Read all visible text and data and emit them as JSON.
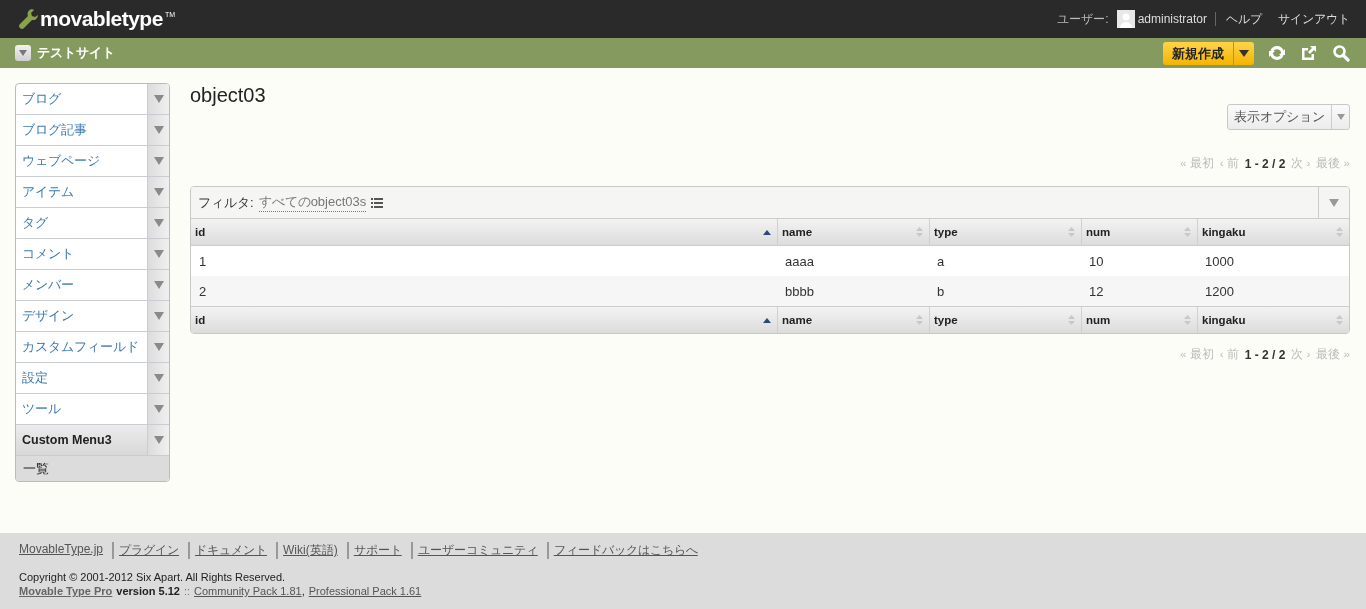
{
  "header": {
    "logo": "movabletype",
    "trademark": "TM",
    "user_label": "ユーザー:",
    "user_name": "administrator",
    "links": [
      "ヘルプ",
      "サインアウト"
    ]
  },
  "site_bar": {
    "site_name": "テストサイト",
    "create_button": "新規作成"
  },
  "sidebar": {
    "items": [
      {
        "label": "ブログ",
        "expanded": false
      },
      {
        "label": "ブログ記事",
        "expanded": false
      },
      {
        "label": "ウェブページ",
        "expanded": false
      },
      {
        "label": "アイテム",
        "expanded": false
      },
      {
        "label": "タグ",
        "expanded": false
      },
      {
        "label": "コメント",
        "expanded": false
      },
      {
        "label": "メンバー",
        "expanded": false
      },
      {
        "label": "デザイン",
        "expanded": false
      },
      {
        "label": "カスタムフィールド",
        "expanded": false
      },
      {
        "label": "設定",
        "expanded": false
      },
      {
        "label": "ツール",
        "expanded": false
      },
      {
        "label": "Custom Menu3",
        "expanded": true,
        "children": [
          {
            "label": "一覧"
          }
        ]
      }
    ]
  },
  "page_title": "object03",
  "display_options": "表示オプション",
  "pagers": [
    {
      "first": "« 最初",
      "prev": "‹ 前",
      "range": "1 - 2 / 2",
      "next": "次 ›",
      "last": "最後 »",
      "disabled": true
    },
    {
      "first": "« 最初",
      "prev": "‹ 前",
      "range": "1 - 2 / 2",
      "next": "次 ›",
      "last": "最後 »",
      "disabled": true
    }
  ],
  "filter": {
    "label": "フィルタ:",
    "value": "すべてのobject03s"
  },
  "table": {
    "columns": [
      {
        "label": "id",
        "sorted": true
      },
      {
        "label": "name",
        "sorted": false
      },
      {
        "label": "type",
        "sorted": false
      },
      {
        "label": "num",
        "sorted": false
      },
      {
        "label": "kingaku",
        "sorted": false
      }
    ],
    "rows": [
      [
        "1",
        "aaaa",
        "a",
        "10",
        "1000"
      ],
      [
        "2",
        "bbbb",
        "b",
        "12",
        "1200"
      ]
    ],
    "footer_columns": [
      {
        "label": "id",
        "sorted": true
      },
      {
        "label": "name",
        "sorted": false
      },
      {
        "label": "type",
        "sorted": false
      },
      {
        "label": "num",
        "sorted": false
      },
      {
        "label": "kingaku",
        "sorted": false
      }
    ]
  },
  "footer": {
    "links": [
      "MovableType.jp",
      "プラグイン",
      "ドキュメント",
      "Wiki(英語)",
      "サポート",
      "ユーザーコミュニティ",
      "フィードバックはこちらへ"
    ],
    "copyright": "Copyright © 2001-2012 Six Apart. All Rights Reserved.",
    "product": "Movable Type Pro",
    "version": "version 5.12",
    "separator": "::",
    "packs": [
      "Community Pack 1.81",
      "Professional Pack 1.61"
    ],
    "pack_delimiter": ","
  }
}
